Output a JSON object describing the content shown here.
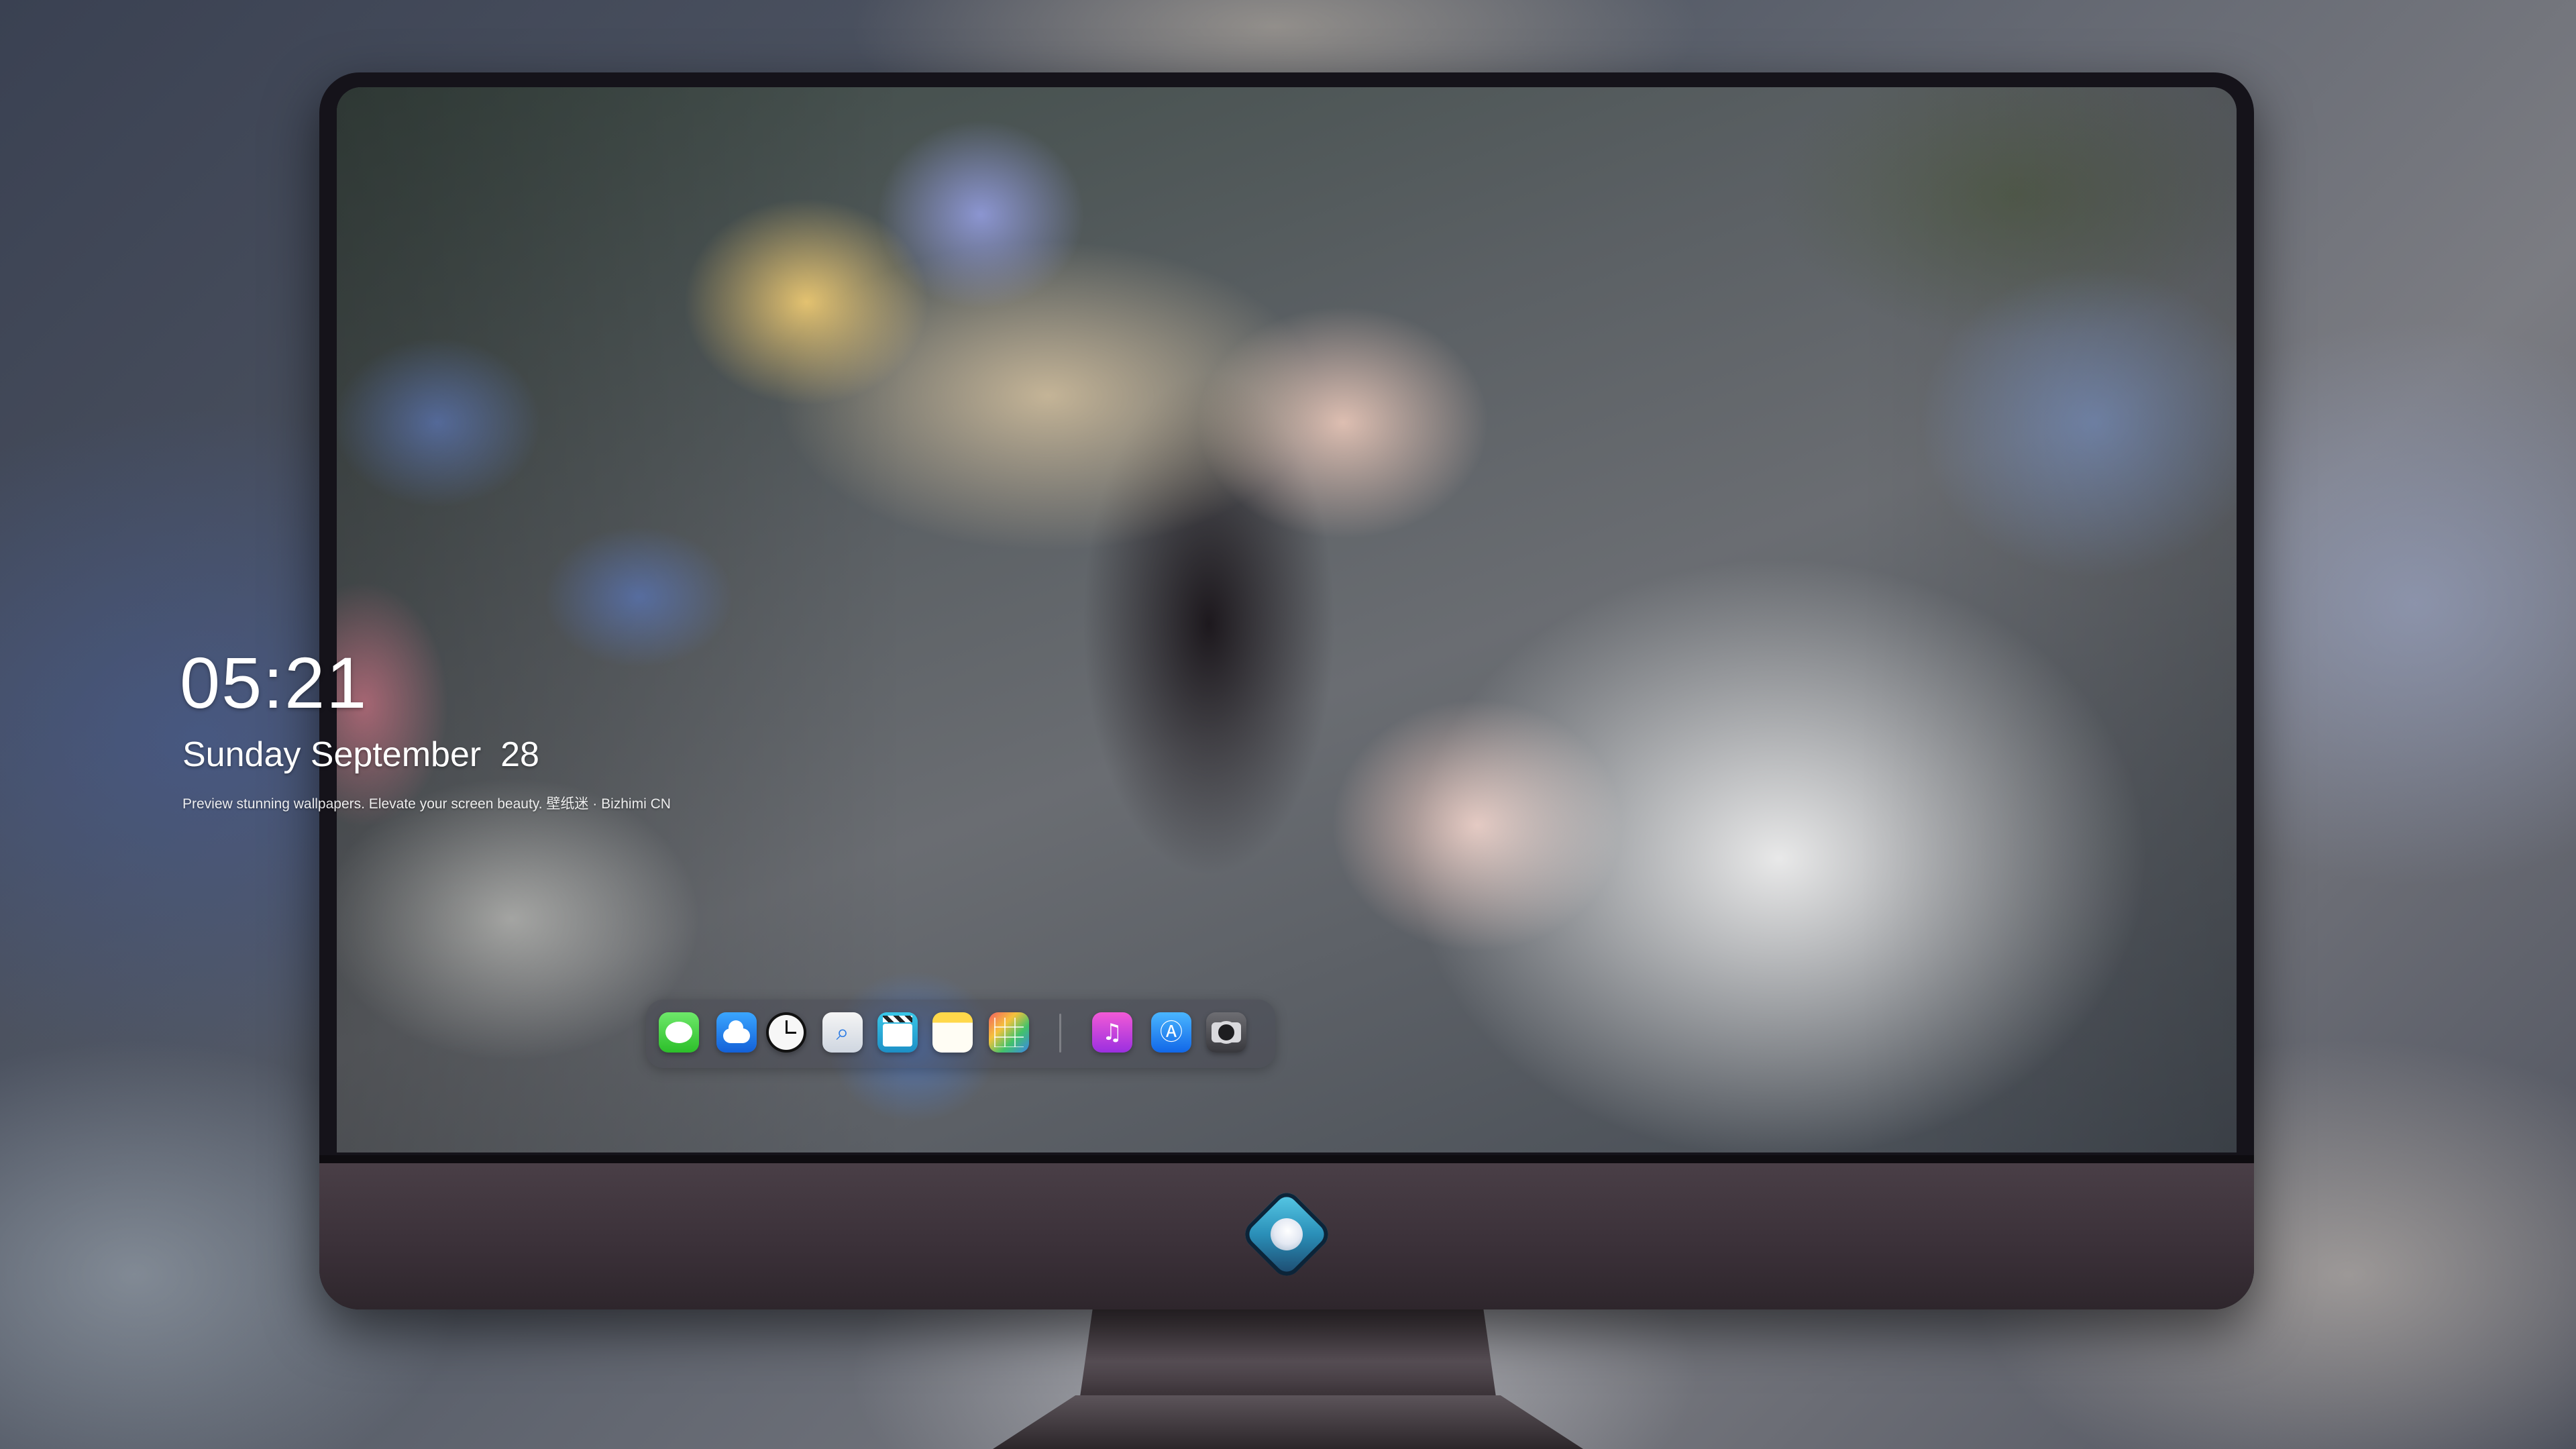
{
  "lock_screen": {
    "time": "05:21",
    "date": "Sunday September  28",
    "tagline": "Preview stunning wallpapers. Elevate your screen beauty. 壁纸迷 · Bizhimi CN"
  },
  "dock": {
    "apps": [
      {
        "name": "Messages",
        "icon": "messages-icon"
      },
      {
        "name": "Weather",
        "icon": "weather-icon"
      },
      {
        "name": "Clock",
        "icon": "clock-icon"
      },
      {
        "name": "Preview",
        "icon": "preview-icon",
        "glyph": "⌕"
      },
      {
        "name": "Videos",
        "icon": "clapperboard-icon"
      },
      {
        "name": "Notes",
        "icon": "notes-icon"
      },
      {
        "name": "Photos",
        "icon": "photos-icon"
      },
      {
        "name": "Music",
        "icon": "music-icon",
        "glyph": "♫"
      },
      {
        "name": "App Store",
        "icon": "app-store-icon",
        "glyph": "Ⓐ"
      },
      {
        "name": "Camera",
        "icon": "camera-icon"
      }
    ]
  },
  "monitor": {
    "logo_icon": "brand-logo-icon"
  },
  "colors": {
    "bezel": "#15131a",
    "chin": "#3a3038",
    "text": "#ffffff"
  }
}
